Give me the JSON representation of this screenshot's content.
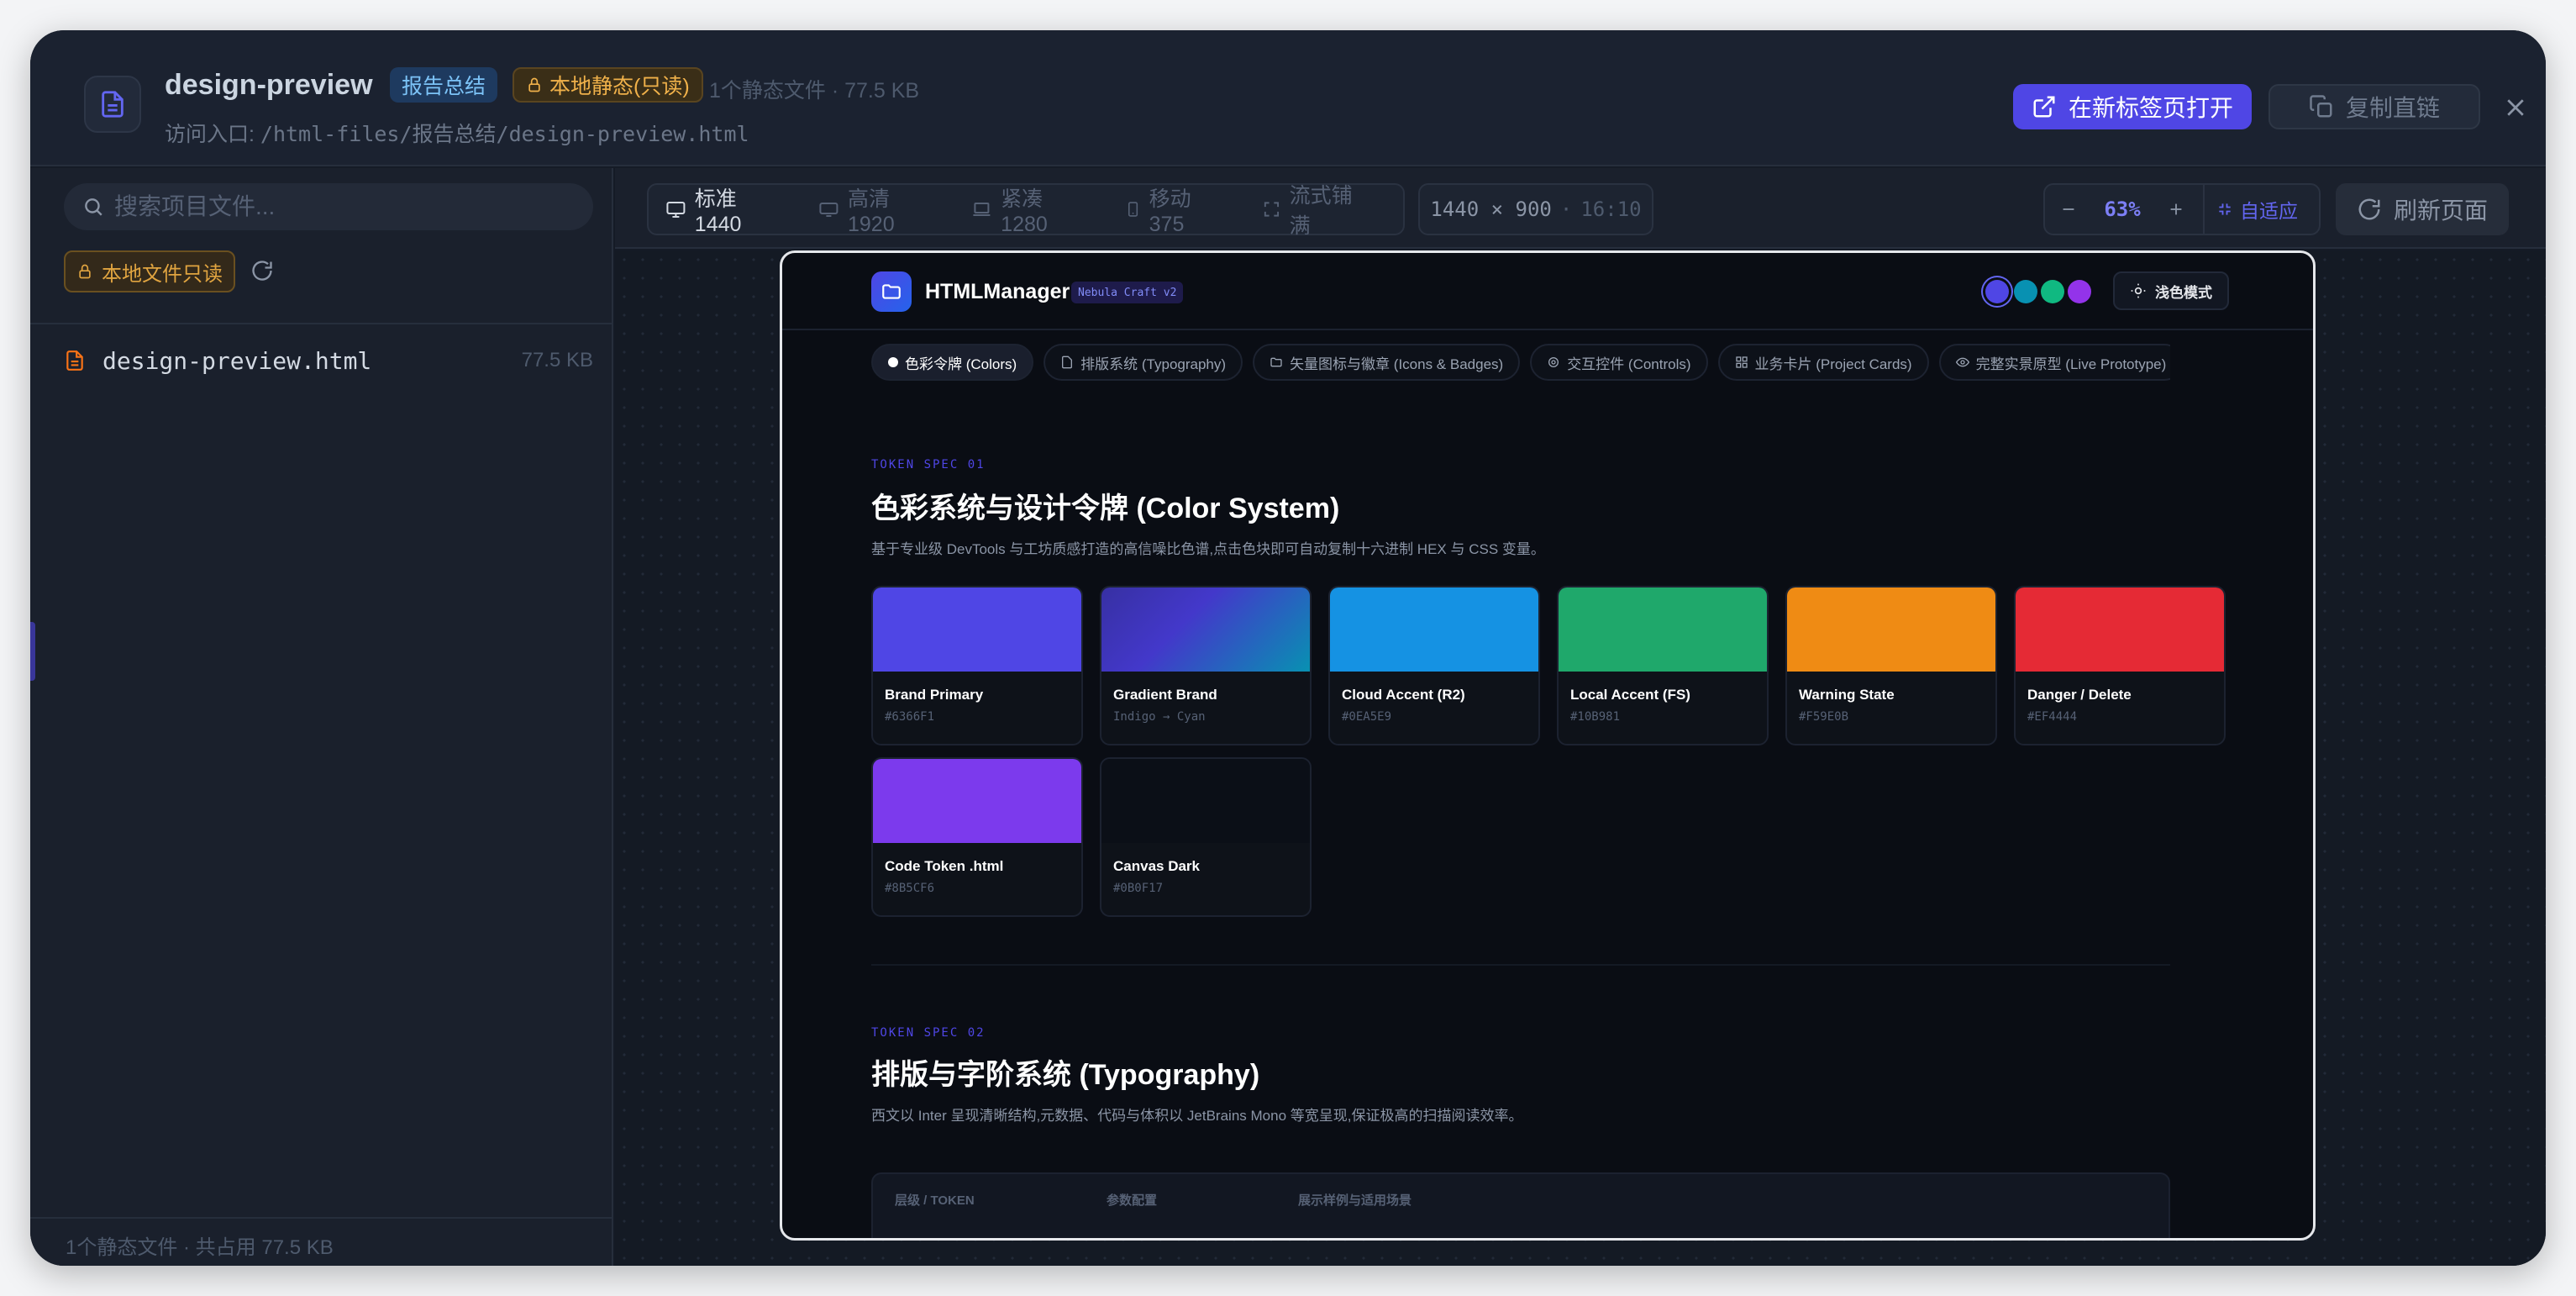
{
  "header": {
    "title": "design-preview",
    "tag_report": "报告总结",
    "tag_readonly": "本地静态(只读)",
    "meta": "1个静态文件 · 77.5 KB",
    "access_label": "访问入口:",
    "access_path": "/html-files/报告总结/design-preview.html",
    "open_button": "在新标签页打开",
    "copy_button": "复制直链"
  },
  "sidebar": {
    "search_placeholder": "搜索项目文件...",
    "readonly_button": "本地文件只读",
    "files": [
      {
        "name": "design-preview.html",
        "size": "77.5 KB"
      }
    ],
    "footer": "1个静态文件 · 共占用 77.5 KB"
  },
  "toolbar": {
    "viewports": [
      {
        "label": "标准 1440",
        "icon": "monitor-icon",
        "active": true
      },
      {
        "label": "高清 1920",
        "icon": "display-icon",
        "active": false
      },
      {
        "label": "紧凑 1280",
        "icon": "laptop-icon",
        "active": false
      },
      {
        "label": "移动 375",
        "icon": "phone-icon",
        "active": false
      },
      {
        "label": "流式铺满",
        "icon": "expand-icon",
        "active": false
      }
    ],
    "resolution": "1440 × 900",
    "ratio": "16:10",
    "zoom": "63%",
    "fit_label": "自适应",
    "refresh_label": "刷新页面"
  },
  "preview": {
    "brand": "HTMLManager",
    "badge": "Nebula Craft v2",
    "theme_button": "浅色模式",
    "theme_dots": [
      "#4f46e5",
      "#0891b2",
      "#10b981",
      "#9333ea"
    ],
    "tabs": [
      {
        "label": "色彩令牌 (Colors)",
        "active": true
      },
      {
        "label": "排版系统 (Typography)",
        "active": false
      },
      {
        "label": "矢量图标与徽章 (Icons & Badges)",
        "active": false
      },
      {
        "label": "交互控件 (Controls)",
        "active": false
      },
      {
        "label": "业务卡片 (Project Cards)",
        "active": false
      },
      {
        "label": "完整实景原型 (Live Prototype)",
        "active": false
      }
    ],
    "spec1": {
      "kicker": "TOKEN SPEC 01",
      "title": "色彩系统与设计令牌 (Color System)",
      "desc": "基于专业级 DevTools 与工坊质感打造的高信噪比色谱,点击色块即可自动复制十六进制 HEX 与 CSS 变量。"
    },
    "swatches": [
      {
        "name": "Brand Primary",
        "code": "#6366F1",
        "color": "#4f46e5"
      },
      {
        "name": "Gradient Brand",
        "code": "Indigo → Cyan",
        "color": "linear-gradient(135deg,#3730a3,#4338ca 40%,#0891b2)"
      },
      {
        "name": "Cloud Accent (R2)",
        "code": "#0EA5E9",
        "color": "#1592e3"
      },
      {
        "name": "Local Accent (FS)",
        "code": "#10B981",
        "color": "#1fa86b"
      },
      {
        "name": "Warning State",
        "code": "#F59E0B",
        "color": "#ef8b14"
      },
      {
        "name": "Danger / Delete",
        "code": "#EF4444",
        "color": "#e52a35"
      },
      {
        "name": "Code Token .html",
        "code": "#8B5CF6",
        "color": "#7c3aed"
      },
      {
        "name": "Canvas Dark",
        "code": "#0B0F17",
        "color": "#0b0f17"
      }
    ],
    "spec2": {
      "kicker": "TOKEN SPEC 02",
      "title": "排版与字阶系统 (Typography)",
      "desc": "西文以 Inter 呈现清晰结构,元数据、代码与体积以 JetBrains Mono 等宽呈现,保证极高的扫描阅读效率。"
    },
    "table_headers": [
      "层级 / TOKEN",
      "参数配置",
      "展示样例与适用场景"
    ]
  },
  "colors": {
    "accent": "#4f46e5",
    "warning": "#f0b14a",
    "info": "#7cc3f7"
  }
}
